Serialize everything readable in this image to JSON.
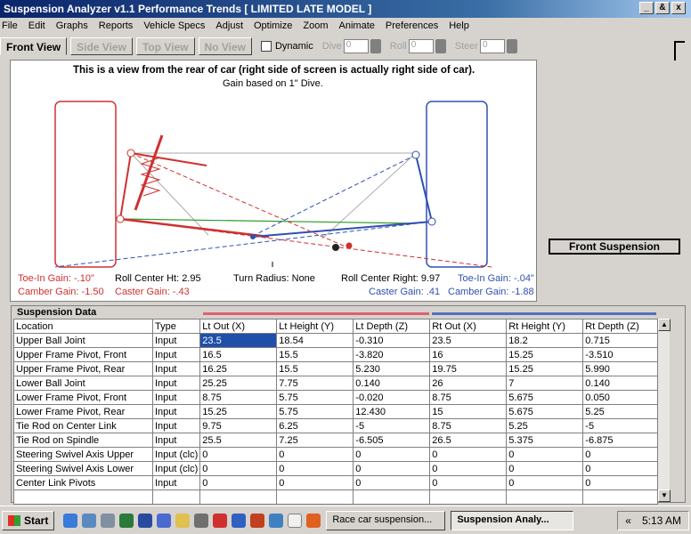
{
  "window": {
    "title": "Suspension Analyzer v1.1  Performance Trends  [ LIMITED LATE MODEL ]",
    "buttons": [
      "_",
      "&",
      "x"
    ]
  },
  "menu": [
    "File",
    "Edit",
    "Graphs",
    "Reports",
    "Vehicle Specs",
    "Adjust",
    "Optimize",
    "Zoom",
    "Animate",
    "Preferences",
    "Help"
  ],
  "tabs": [
    "Front View",
    "Side View",
    "Top View",
    "No View"
  ],
  "dynamic_label": "Dynamic",
  "spinners": [
    {
      "label": "Dive",
      "value": "0"
    },
    {
      "label": "Roll",
      "value": "0"
    },
    {
      "label": "Steer",
      "value": "0"
    }
  ],
  "view": {
    "heading": "This is a view from the rear of car (right side of screen is actually right side of car).",
    "subheading": "Gain based on 1\" Dive.",
    "toe_in_left": "Toe-In Gain: -.10\"",
    "camber_left": "Camber Gain: -1.50",
    "roll_center_ht": "Roll Center Ht: 2.95",
    "caster_left": "Caster Gain: -.43",
    "turn_radius": "Turn Radius: None",
    "roll_center_right": "Roll Center Right: 9.97",
    "toe_in_right": "Toe-In Gain: -.04\"",
    "caster_right": "Caster Gain: .41",
    "camber_right": "Camber Gain: -1.88"
  },
  "front_suspension_button": "Front Suspension",
  "data": {
    "label": "Suspension Data",
    "headers": [
      "Location",
      "Type",
      "Lt Out (X)",
      "Lt Height (Y)",
      "Lt Depth (Z)",
      "Rt Out (X)",
      "Rt Height (Y)",
      "Rt Depth (Z)"
    ],
    "rows": [
      [
        "Upper Ball Joint",
        "Input",
        "23.5",
        "18.54",
        "-0.310",
        "23.5",
        "18.2",
        "0.715"
      ],
      [
        "Upper Frame Pivot, Front",
        "Input",
        "16.5",
        "15.5",
        "-3.820",
        "16",
        "15.25",
        "-3.510"
      ],
      [
        "Upper Frame Pivot, Rear",
        "Input",
        "16.25",
        "15.5",
        "5.230",
        "19.75",
        "15.25",
        "5.990"
      ],
      [
        "Lower Ball Joint",
        "Input",
        "25.25",
        "7.75",
        "0.140",
        "26",
        "7",
        "0.140"
      ],
      [
        "Lower Frame Pivot, Front",
        "Input",
        "8.75",
        "5.75",
        "-0.020",
        "8.75",
        "5.675",
        "0.050"
      ],
      [
        "Lower Frame Pivot, Rear",
        "Input",
        "15.25",
        "5.75",
        "12.430",
        "15",
        "5.675",
        "5.25"
      ],
      [
        "Tie Rod on Center Link",
        "Input",
        "9.75",
        "6.25",
        "-5",
        "8.75",
        "5.25",
        "-5"
      ],
      [
        "Tie Rod on Spindle",
        "Input",
        "25.5",
        "7.25",
        "-6.505",
        "26.5",
        "5.375",
        "-6.875"
      ],
      [
        "Steering Swivel Axis Upper",
        "Input (clc)",
        "0",
        "0",
        "0",
        "0",
        "0",
        "0"
      ],
      [
        "Steering Swivel Axis Lower",
        "Input (clc)",
        "0",
        "0",
        "0",
        "0",
        "0",
        "0"
      ],
      [
        "Center Link Pivots",
        "Input",
        "0",
        "0",
        "0",
        "0",
        "0",
        "0"
      ],
      [
        "",
        "",
        "",
        "",
        "",
        "",
        "",
        ""
      ]
    ]
  },
  "taskbar": {
    "start": "Start",
    "tasks": [
      "Race car suspension...",
      "Suspension Analy..."
    ],
    "tray_arrows": "«",
    "clock": "5:13 AM"
  },
  "colors": {
    "left": "#d03030",
    "right": "#3050b0",
    "selected": "#1f4fa8"
  }
}
